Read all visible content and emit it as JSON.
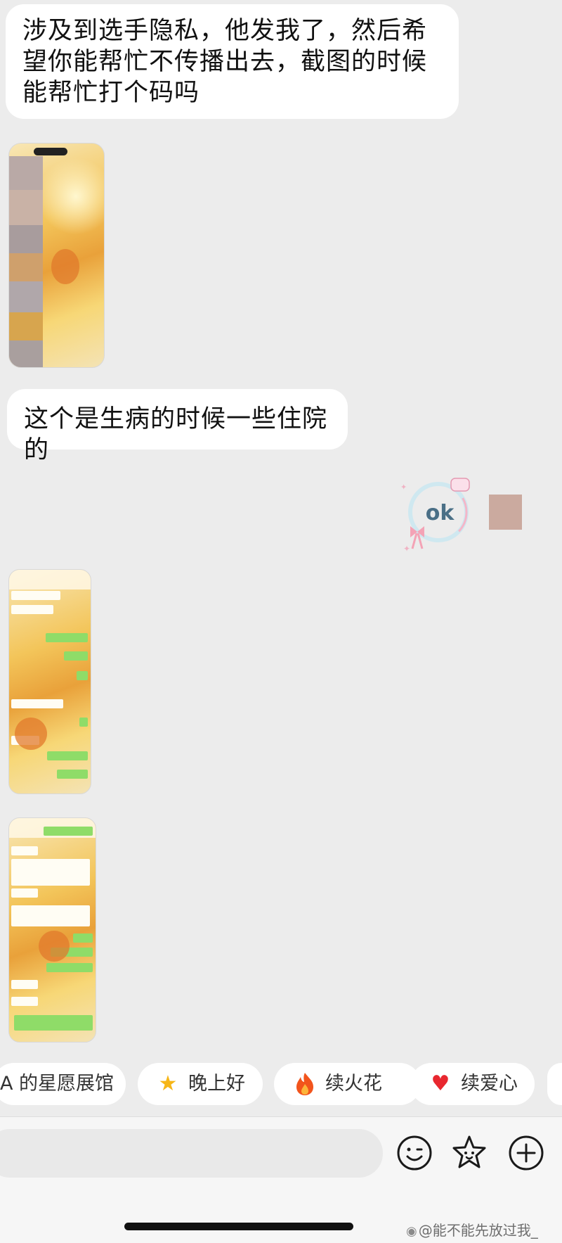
{
  "messages": {
    "first_text": "涉及到选手隐私，他发我了，然后希望你能帮忙不传播出去，截图的时候能帮忙打个码吗",
    "second_text": "这个是生病的时候一些住院的"
  },
  "sticker": {
    "text": "ok"
  },
  "quick_replies": [
    {
      "label": "A 的星愿展馆",
      "icon": ""
    },
    {
      "label": "晚上好",
      "icon": "star-icon"
    },
    {
      "label": "续火花",
      "icon": "fire-icon"
    },
    {
      "label": "续爱心",
      "icon": "heart-icon"
    }
  ],
  "input": {
    "value": "",
    "placeholder": ""
  },
  "watermark": "@能不能先放过我_",
  "colors": {
    "background": "#ececec",
    "bubble": "#ffffff",
    "chat_green": "#8fdc68",
    "avatar": "#cbaa9f"
  }
}
